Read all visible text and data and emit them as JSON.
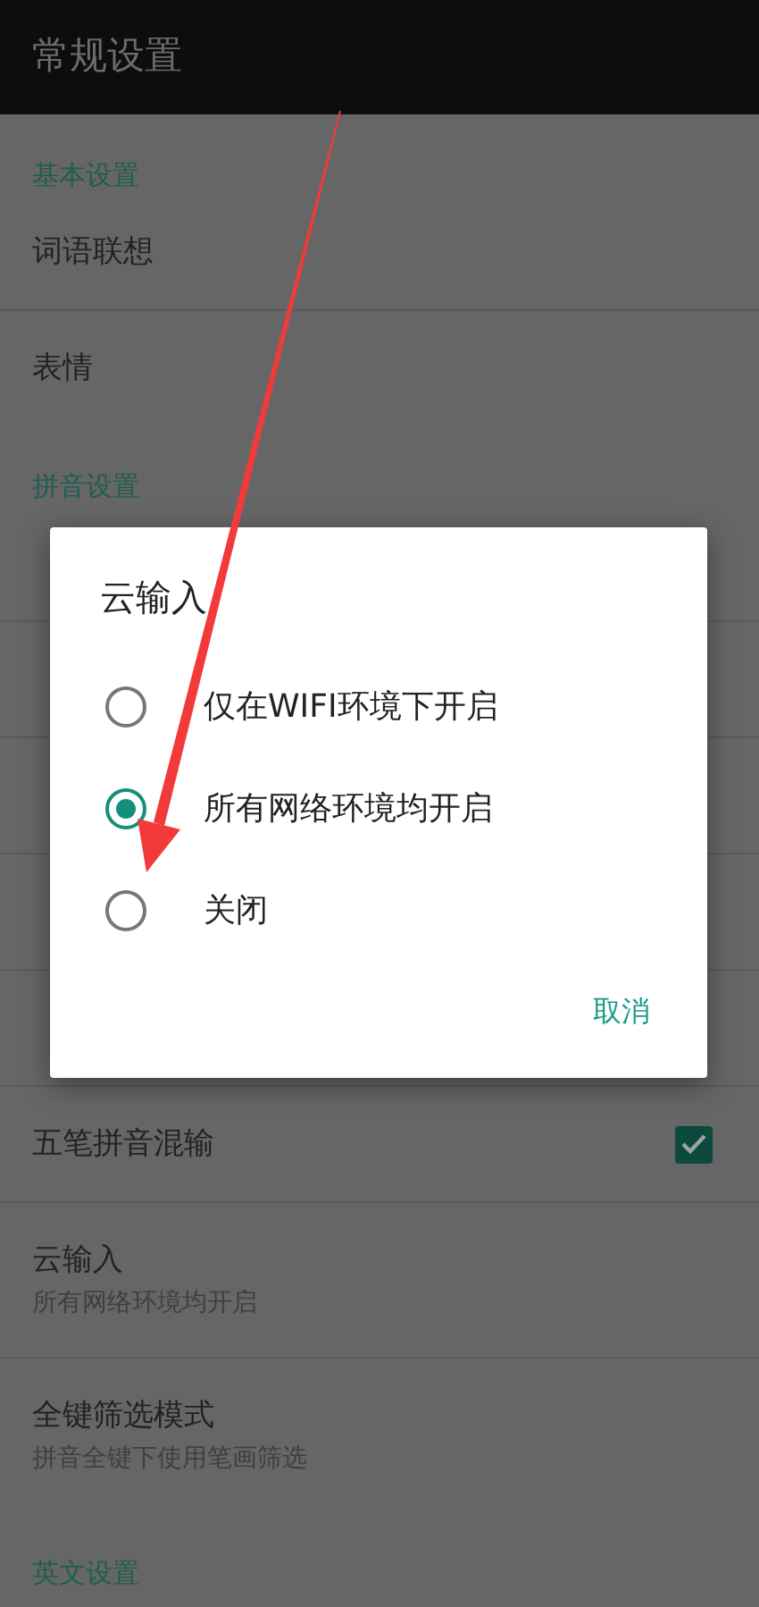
{
  "app_bar": {
    "title": "常规设置"
  },
  "sections": [
    {
      "title": "基本设置",
      "items": [
        {
          "kind": "plain",
          "label": "词语联想"
        },
        {
          "kind": "plain",
          "label": "表情"
        }
      ]
    },
    {
      "title": "拼音设置",
      "items": [
        {
          "kind": "covered"
        },
        {
          "kind": "covered"
        },
        {
          "kind": "covered"
        },
        {
          "kind": "covered"
        },
        {
          "kind": "covered"
        },
        {
          "kind": "checkbox",
          "label": "五笔拼音混输",
          "checked": true
        },
        {
          "kind": "plain",
          "label": "云输入",
          "summary": "所有网络环境均开启"
        },
        {
          "kind": "plain",
          "label": "全键筛选模式",
          "summary": "拼音全键下使用笔画筛选"
        }
      ]
    },
    {
      "title": "英文设置"
    }
  ],
  "dialog": {
    "title": "云输入",
    "options": [
      {
        "label": "仅在WIFI环境下开启",
        "selected": false
      },
      {
        "label": "所有网络环境均开启",
        "selected": true
      },
      {
        "label": "关闭",
        "selected": false
      }
    ],
    "buttons": [
      "取消"
    ]
  }
}
